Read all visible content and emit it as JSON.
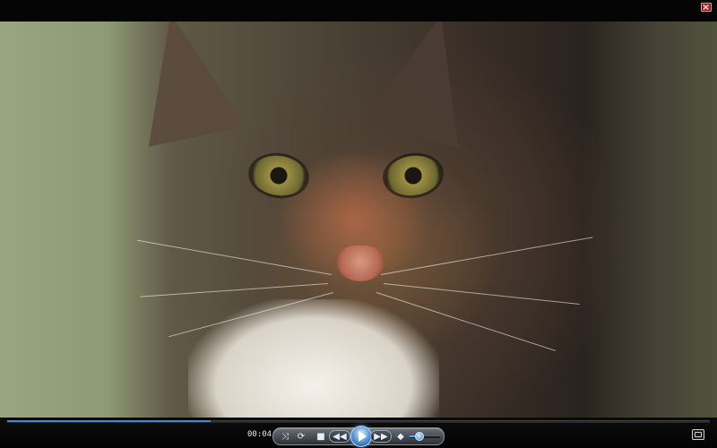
{
  "player": {
    "current_time": "00:04",
    "progress": 0.29,
    "volume": 0.3,
    "icons": {
      "close": "close-icon",
      "shuffle": "shuffle-icon",
      "repeat": "repeat-icon",
      "stop": "stop-icon",
      "previous": "previous-icon",
      "play": "play-icon",
      "next": "next-icon",
      "mute": "speaker-icon",
      "switch_mode": "switch-to-library-icon"
    }
  },
  "colors": {
    "accent": "#4a86c5",
    "close": "#c9333a"
  }
}
